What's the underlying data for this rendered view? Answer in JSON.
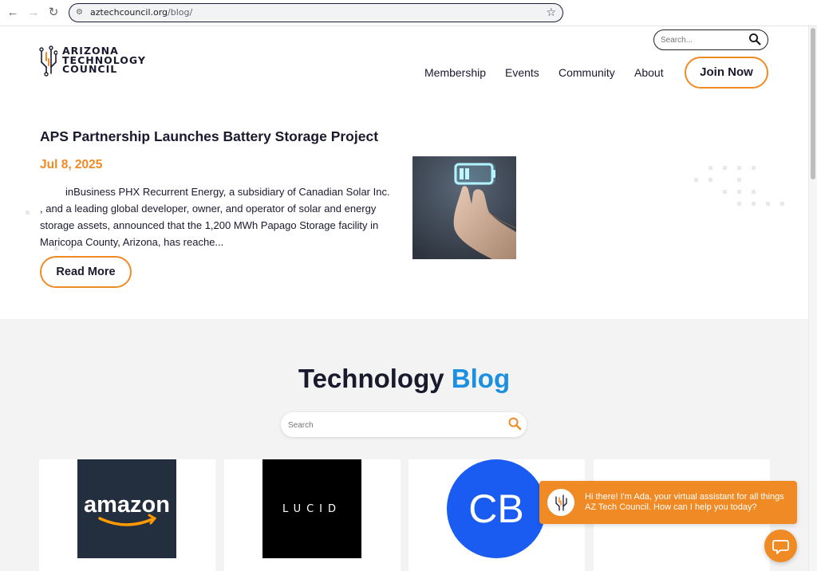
{
  "browser": {
    "url_domain": "aztechcouncil.org",
    "url_path": "/blog/"
  },
  "header": {
    "logo_lines": [
      "Arizona",
      "Technology",
      "Council"
    ],
    "search_placeholder": "Search...",
    "nav": [
      "Membership",
      "Events",
      "Community",
      "About"
    ],
    "join_label": "Join Now"
  },
  "featured_post": {
    "title": "APS Partnership Launches Battery Storage Project",
    "date": "Jul 8, 2025",
    "excerpt": "inBusiness PHX Recurrent Energy, a subsidiary of Canadian Solar Inc. , and a leading global developer, owner, and operator of solar and energy storage assets, announced that the 1,200 MWh Papago Storage facility in Maricopa County, Arizona, has reache...",
    "read_more_label": "Read More"
  },
  "blog": {
    "heading_main": "Technology",
    "heading_accent": "Blog",
    "search_placeholder": "Search"
  },
  "cards": [
    {
      "thumb_text": "amazon",
      "thumb_bg": "#232f3e"
    },
    {
      "thumb_text": "LUCID",
      "thumb_bg": "#000000"
    },
    {
      "thumb_text": "CB",
      "thumb_bg": "#1a5cf2"
    },
    {
      "thumb_text": "",
      "thumb_bg": "#ffffff"
    }
  ],
  "chat": {
    "message": "Hi there! I'm Ada, your virtual assistant for all things AZ Tech Council. How can I help you today?"
  },
  "colors": {
    "accent_orange": "#f08a24",
    "accent_blue": "#1d8fe1",
    "text_dark": "#1a1a2e"
  }
}
